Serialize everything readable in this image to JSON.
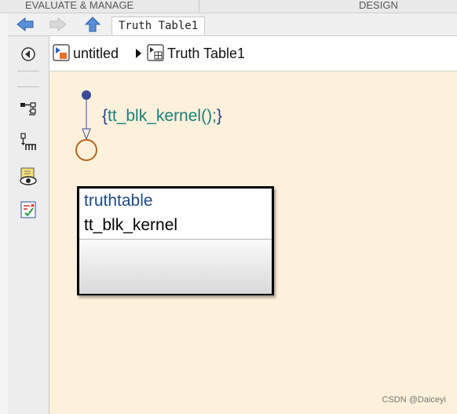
{
  "ribbon": {
    "evaluate_label": "EVALUATE & MANAGE",
    "design_label": "DESIGN"
  },
  "nav": {
    "tab_label": "Truth Table1"
  },
  "breadcrumb": {
    "root": "untitled",
    "current": "Truth Table1"
  },
  "canvas": {
    "action_open": "{",
    "action_text": "tt_blk_kernel();",
    "action_close": "}",
    "truth_table": {
      "type_label": "truthtable",
      "name": "tt_blk_kernel"
    }
  },
  "watermark": "CSDN @Daiceyi",
  "colors": {
    "canvas": "#fdf1dc",
    "action_text": "#1a7f7a",
    "junction": "#b8661b",
    "default_dot": "#3a4a9a"
  }
}
